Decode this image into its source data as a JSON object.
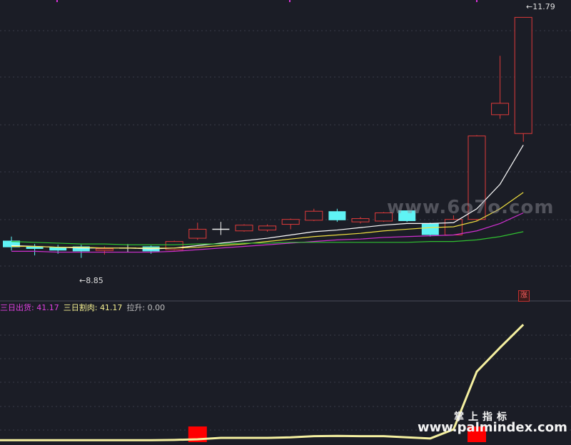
{
  "chart_data": [
    {
      "type": "candlestick",
      "high_label": "11.79",
      "low_label": "8.85",
      "ylim": [
        8.55,
        11.95
      ],
      "candles": [
        {
          "o": 9.06,
          "c": 8.98,
          "h": 9.11,
          "l": 8.94,
          "color": "cyan"
        },
        {
          "o": 8.99,
          "c": 8.96,
          "h": 9.02,
          "l": 8.88,
          "color": "cyan"
        },
        {
          "o": 8.98,
          "c": 8.94,
          "h": 9.01,
          "l": 8.9,
          "color": "cyan"
        },
        {
          "o": 8.99,
          "c": 8.93,
          "h": 9.01,
          "l": 8.85,
          "color": "cyan"
        },
        {
          "o": 8.94,
          "c": 8.96,
          "h": 8.99,
          "l": 8.89,
          "color": "red"
        },
        {
          "o": 8.97,
          "c": 8.97,
          "h": 9.02,
          "l": 8.92,
          "color": "white"
        },
        {
          "o": 8.99,
          "c": 8.93,
          "h": 9.0,
          "l": 8.9,
          "color": "cyan"
        },
        {
          "o": 8.95,
          "c": 9.05,
          "h": 9.06,
          "l": 8.94,
          "color": "red"
        },
        {
          "o": 9.09,
          "c": 9.2,
          "h": 9.28,
          "l": 9.07,
          "color": "red"
        },
        {
          "o": 9.2,
          "c": 9.2,
          "h": 9.29,
          "l": 9.13,
          "color": "white"
        },
        {
          "o": 9.18,
          "c": 9.25,
          "h": 9.26,
          "l": 9.17,
          "color": "red"
        },
        {
          "o": 9.19,
          "c": 9.24,
          "h": 9.26,
          "l": 9.17,
          "color": "red"
        },
        {
          "o": 9.26,
          "c": 9.32,
          "h": 9.33,
          "l": 9.2,
          "color": "red"
        },
        {
          "o": 9.31,
          "c": 9.42,
          "h": 9.45,
          "l": 9.3,
          "color": "red"
        },
        {
          "o": 9.42,
          "c": 9.31,
          "h": 9.45,
          "l": 9.29,
          "color": "cyan"
        },
        {
          "o": 9.29,
          "c": 9.33,
          "h": 9.35,
          "l": 9.27,
          "color": "red"
        },
        {
          "o": 9.3,
          "c": 9.4,
          "h": 9.41,
          "l": 9.29,
          "color": "red"
        },
        {
          "o": 9.43,
          "c": 9.3,
          "h": 9.43,
          "l": 9.29,
          "color": "cyan"
        },
        {
          "o": 9.27,
          "c": 9.13,
          "h": 9.28,
          "l": 9.11,
          "color": "cyan"
        },
        {
          "o": 9.13,
          "c": 9.32,
          "h": 9.37,
          "l": 9.13,
          "color": "red"
        },
        {
          "o": 9.32,
          "c": 10.34,
          "h": 10.35,
          "l": 9.3,
          "color": "red"
        },
        {
          "o": 10.6,
          "c": 10.74,
          "h": 11.32,
          "l": 10.55,
          "color": "red"
        },
        {
          "o": 10.37,
          "c": 11.79,
          "h": 11.79,
          "l": 10.27,
          "color": "red"
        }
      ],
      "ma_series": [
        {
          "color": "#ffffff",
          "values": [
            9.0,
            8.99,
            8.98,
            8.97,
            8.97,
            8.97,
            8.96,
            8.97,
            9.0,
            9.03,
            9.06,
            9.09,
            9.13,
            9.17,
            9.19,
            9.22,
            9.25,
            9.27,
            9.27,
            9.28,
            9.45,
            9.75,
            10.23
          ]
        },
        {
          "color": "#f0e040",
          "values": [
            8.99,
            8.99,
            8.98,
            8.98,
            8.97,
            8.97,
            8.97,
            8.97,
            8.98,
            9.0,
            9.02,
            9.05,
            9.08,
            9.11,
            9.13,
            9.15,
            9.18,
            9.2,
            9.22,
            9.23,
            9.3,
            9.45,
            9.65
          ]
        },
        {
          "color": "#d030d0",
          "values": [
            8.93,
            8.93,
            8.92,
            8.92,
            8.92,
            8.92,
            8.92,
            8.93,
            8.95,
            8.97,
            8.99,
            9.01,
            9.03,
            9.05,
            9.07,
            9.08,
            9.1,
            9.11,
            9.12,
            9.13,
            9.18,
            9.27,
            9.4
          ]
        },
        {
          "color": "#30c030",
          "values": [
            9.05,
            9.04,
            9.03,
            9.02,
            9.02,
            9.01,
            9.01,
            9.01,
            9.02,
            9.02,
            9.03,
            9.03,
            9.04,
            9.04,
            9.04,
            9.04,
            9.04,
            9.04,
            9.05,
            9.05,
            9.07,
            9.11,
            9.17
          ]
        }
      ]
    },
    {
      "type": "line",
      "labels": [
        {
          "name": "三日出货:",
          "value": "41.17",
          "color": "#e040e0"
        },
        {
          "name": "三日割肉:",
          "value": "41.17",
          "color": "#f5f090"
        },
        {
          "name": "拉升:",
          "value": "0.00",
          "color": "#c0c0c0"
        }
      ],
      "ylim": [
        0,
        45
      ],
      "series": [
        {
          "color": "#f5f0a0",
          "values": [
            0.2,
            0.2,
            0.2,
            0.2,
            0.2,
            0.2,
            0.2,
            0.3,
            0.5,
            1.0,
            1.0,
            1.0,
            1.2,
            1.6,
            1.7,
            1.6,
            1.6,
            1.2,
            0.8,
            4.0,
            24.5,
            33.0,
            41.17
          ]
        }
      ],
      "red_markers": [
        8,
        20
      ]
    }
  ],
  "misc": {
    "limit_up_tag": "涨",
    "watermarks": [
      "www.6o7o.com",
      "掌上指标",
      "www.palmindex.com"
    ]
  }
}
